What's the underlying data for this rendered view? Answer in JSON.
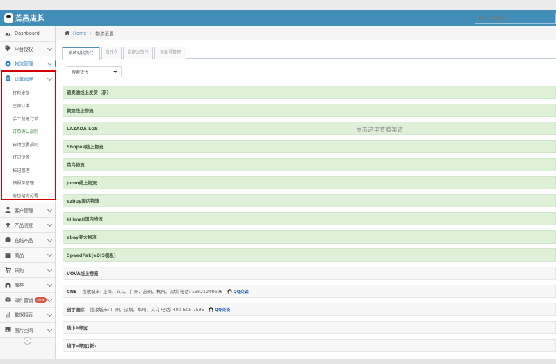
{
  "brand": {
    "title": "芒果店长",
    "subtitle": "mangoerp.com"
  },
  "search": {
    "placeholder": "帮助文档搜索"
  },
  "sidebar": {
    "items_top": [
      {
        "label": "Dashboard",
        "icon": "dashboard-icon"
      },
      {
        "label": "平台授权",
        "icon": "tag-icon"
      },
      {
        "label": "物流管理",
        "icon": "logistics-icon"
      }
    ],
    "order": {
      "label": "订单管理",
      "icon": "clipboard-icon",
      "sub": [
        "打包发货",
        "全部订单",
        "手工创建订单",
        "订单确认规则",
        "自动包裹规则",
        "打印设置",
        "标记管理",
        "预报单管理",
        "发货留言设置"
      ]
    },
    "items_bottom": [
      {
        "label": "客户管理",
        "icon": "users-icon"
      },
      {
        "label": "产品刊登",
        "icon": "upload-icon"
      },
      {
        "label": "在线产品",
        "icon": "cube-icon"
      },
      {
        "label": "商品",
        "icon": "box-icon"
      },
      {
        "label": "采购",
        "icon": "cart-icon"
      },
      {
        "label": "库存",
        "icon": "warehouse-icon"
      },
      {
        "label": "邮件营销",
        "icon": "mail-icon",
        "badge": "new"
      },
      {
        "label": "数据报表",
        "icon": "chart-icon"
      },
      {
        "label": "图片空间",
        "icon": "image-icon"
      }
    ],
    "collapse": "«"
  },
  "breadcrumb": {
    "home": "Home",
    "current": "物流设置"
  },
  "tabs": [
    "系统对接货代",
    "海外仓",
    "自定义货代",
    "运单号管理"
  ],
  "dropdown": {
    "value": "搜索货代"
  },
  "hint": "点击这里查看渠道",
  "carriers": [
    {
      "name": "速卖通线上发货（新）",
      "style": "green"
    },
    {
      "name": "敦煌线上物流",
      "style": "green"
    },
    {
      "name": "LAZADA LGS",
      "style": "green"
    },
    {
      "name": "Shopee线上物流",
      "style": "green"
    },
    {
      "name": "菜鸟物流",
      "style": "green"
    },
    {
      "name": "joom线上物流",
      "style": "green"
    },
    {
      "name": "ezbuy国内物流",
      "style": "green"
    },
    {
      "name": "kilimall国内物流",
      "style": "green"
    },
    {
      "name": "ebay亚太物流",
      "style": "green"
    },
    {
      "name": "SpeedPak(eDIS模板)",
      "style": "green"
    },
    {
      "name": "VOVA线上物流",
      "style": "white"
    },
    {
      "name": "CNE",
      "style": "white",
      "info": "揽收城市: 上海、义乌、广州、苏州、杭州、深圳    电话: 15821248696",
      "qq": "QQ交谈"
    },
    {
      "name": "创宇国际",
      "style": "white",
      "info": "揽收城市: 广州、深圳、郑州、义乌    电话: 400-605-7585",
      "qq": "QQ交谈"
    },
    {
      "name": "线下e邮宝",
      "style": "white"
    },
    {
      "name": "线下e邮宝(新)",
      "style": "white"
    }
  ],
  "colors": {
    "navbar": "#438eb9",
    "green_row": "#dff0d8",
    "highlight_border": "#d40000"
  }
}
